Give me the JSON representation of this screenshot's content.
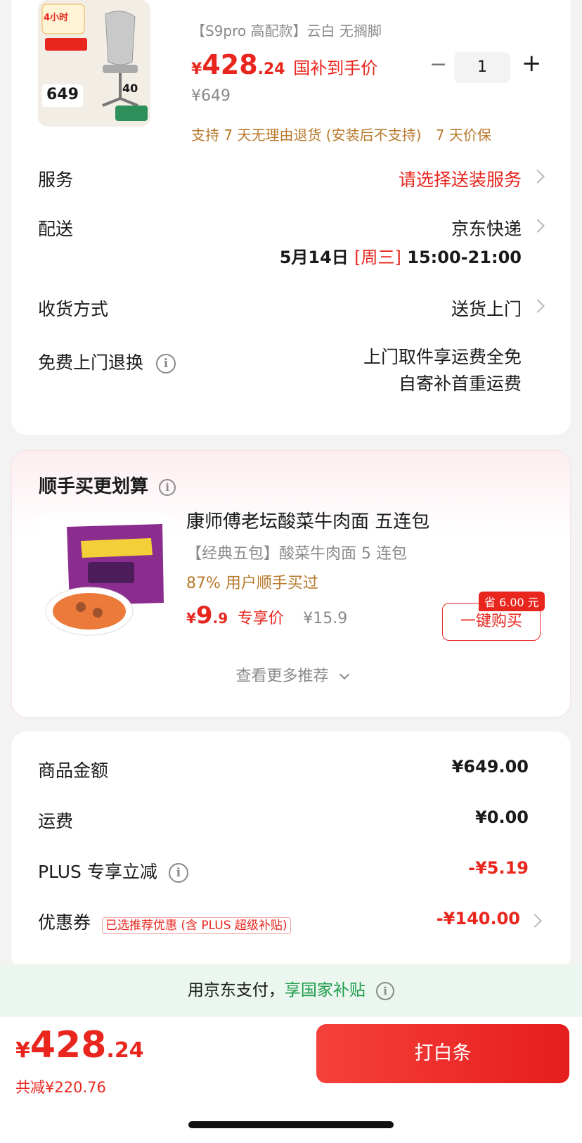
{
  "product": {
    "sku": "【S9pro 高配款】云白 无搁脚",
    "price_symbol": "¥",
    "price_int": "428",
    "price_dec": ".24",
    "price_note": "国补到手价",
    "original_price": "¥649",
    "qty_minus": "−",
    "qty_value": "1",
    "qty_plus": "+",
    "return_policy": "支持 7 天无理由退货 (安装后不支持)",
    "price_protect": "7 天价保",
    "thumb_price": "649",
    "thumb_badge": "4小时",
    "thumb_small": "40"
  },
  "rows": {
    "service_label": "服务",
    "service_value": "请选择送装服务",
    "delivery_label": "配送",
    "delivery_value": "京东快递",
    "delivery_date": "5月14日",
    "delivery_weekday": "[周三]",
    "delivery_time": "15:00-21:00",
    "receive_label": "收货方式",
    "receive_value": "送货上门",
    "free_return_label": "免费上门退换",
    "free_return_value1": "上门取件享运费全免",
    "free_return_value2": "自寄补首重运费"
  },
  "recommend": {
    "title": "顺手买更划算",
    "item_name": "康师傅老坛酸菜牛肉面 五连包",
    "item_sku": "【经典五包】酸菜牛肉面 5 连包",
    "item_stat": "87% 用户顺手买过",
    "price_symbol": "¥",
    "price_int": "9",
    "price_dec": ".9",
    "price_note": "专享价",
    "original_price": "¥15.9",
    "save_tag": "省 6.00 元",
    "buy_label": "一键购买",
    "more_label": "查看更多推荐"
  },
  "summary": {
    "goods_label": "商品金额",
    "goods_value": "¥649.00",
    "shipping_label": "运费",
    "shipping_value": "¥0.00",
    "plus_label": "PLUS 专享立减",
    "plus_value": "-¥5.19",
    "coupon_label": "优惠券",
    "coupon_tag": "已选推荐优惠 (含 PLUS 超级补贴)",
    "coupon_value": "-¥140.00"
  },
  "pay_banner": {
    "text": "用京东支付，",
    "highlight": "享国家补贴"
  },
  "bottom": {
    "price_symbol": "¥",
    "price_int": "428",
    "price_dec": ".24",
    "total_saved": "共减¥220.76",
    "pay_button": "打白条"
  },
  "colors": {
    "accent_red": "#e8261e",
    "gold": "#b8792d",
    "green": "#1e9c4b"
  }
}
